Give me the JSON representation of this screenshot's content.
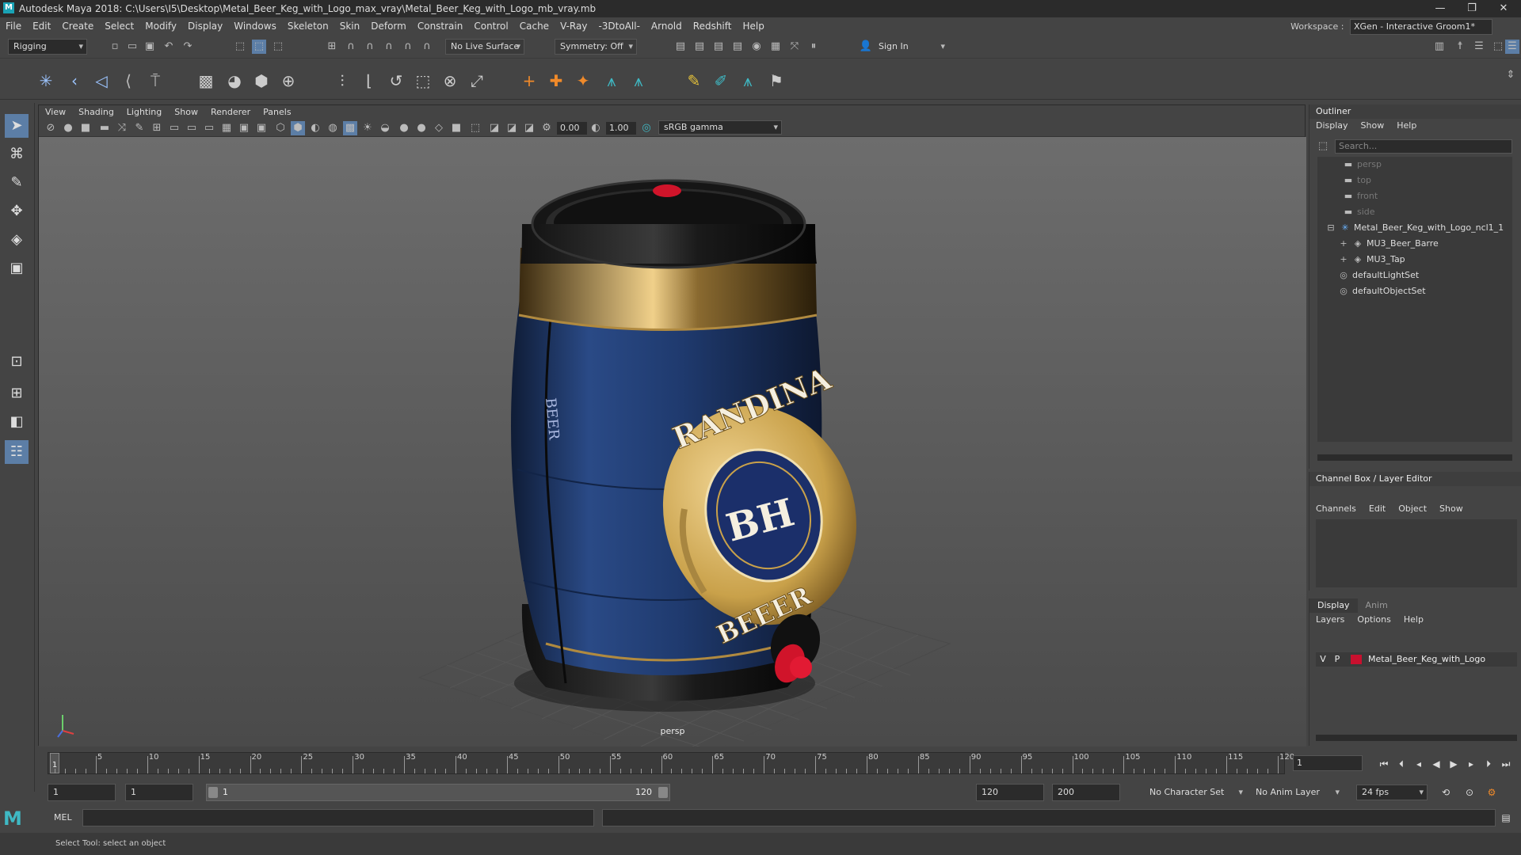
{
  "title": "Autodesk Maya 2018: C:\\Users\\I5\\Desktop\\Metal_Beer_Keg_with_Logo_max_vray\\Metal_Beer_Keg_with_Logo_mb_vray.mb",
  "menu": [
    "File",
    "Edit",
    "Create",
    "Select",
    "Modify",
    "Display",
    "Windows",
    "Skeleton",
    "Skin",
    "Deform",
    "Constrain",
    "Control",
    "Cache",
    "V-Ray",
    "-3DtoAll-",
    "Arnold",
    "Redshift",
    "Help"
  ],
  "workspace": {
    "label": "Workspace :",
    "value": "XGen - Interactive Groom1*"
  },
  "status": {
    "mode": "Rigging",
    "live_surface": "No Live Surface",
    "symmetry": "Symmetry: Off",
    "sign_in": "Sign In"
  },
  "viewport": {
    "menu": [
      "View",
      "Shading",
      "Lighting",
      "Show",
      "Renderer",
      "Panels"
    ],
    "exposure": "0.00",
    "gamma": "1.00",
    "colorspace": "sRGB gamma",
    "camera": "persp"
  },
  "keg": {
    "logo_top": "RANDINA",
    "logo_mid": "BH",
    "logo_bottom": "BEEER",
    "side_text": "BEER",
    "body_color": "#1f3a6e",
    "gold": "#c9a14a",
    "tap_color": "#d0142a"
  },
  "outliner": {
    "title": "Outliner",
    "menu": [
      "Display",
      "Show",
      "Help"
    ],
    "search": "Search...",
    "items": [
      {
        "label": "persp",
        "icon": "camera-icon"
      },
      {
        "label": "top",
        "icon": "camera-icon"
      },
      {
        "label": "front",
        "icon": "camera-icon"
      },
      {
        "label": "side",
        "icon": "camera-icon"
      },
      {
        "label": "Metal_Beer_Keg_with_Logo_ncl1_1",
        "icon": "group-icon"
      },
      {
        "label": "MU3_Beer_Barre",
        "icon": "mesh-icon"
      },
      {
        "label": "MU3_Tap",
        "icon": "mesh-icon"
      },
      {
        "label": "defaultLightSet",
        "icon": "set-icon"
      },
      {
        "label": "defaultObjectSet",
        "icon": "set-icon"
      }
    ]
  },
  "channelbox": {
    "title": "Channel Box / Layer Editor",
    "menu": [
      "Channels",
      "Edit",
      "Object",
      "Show"
    ]
  },
  "layers": {
    "tabs": [
      "Display",
      "Anim"
    ],
    "menu": [
      "Layers",
      "Options",
      "Help"
    ],
    "row": {
      "v": "V",
      "p": "P",
      "name": "Metal_Beer_Keg_with_Logo"
    }
  },
  "timeline": {
    "ticks": [
      "5",
      "10",
      "15",
      "20",
      "25",
      "30",
      "35",
      "40",
      "45",
      "50",
      "55",
      "60",
      "65",
      "70",
      "75",
      "80",
      "85",
      "90",
      "95",
      "100",
      "105",
      "110",
      "115",
      "120"
    ],
    "start_marker": "1",
    "current": "1"
  },
  "range": {
    "start": "1",
    "playstart": "1",
    "slider_start": "1",
    "slider_end": "120",
    "end": "120",
    "max": "200",
    "charset": "No Character Set",
    "animlayer": "No Anim Layer",
    "fps": "24 fps"
  },
  "cmd": {
    "label": "MEL"
  },
  "help": "Select Tool: select an object"
}
